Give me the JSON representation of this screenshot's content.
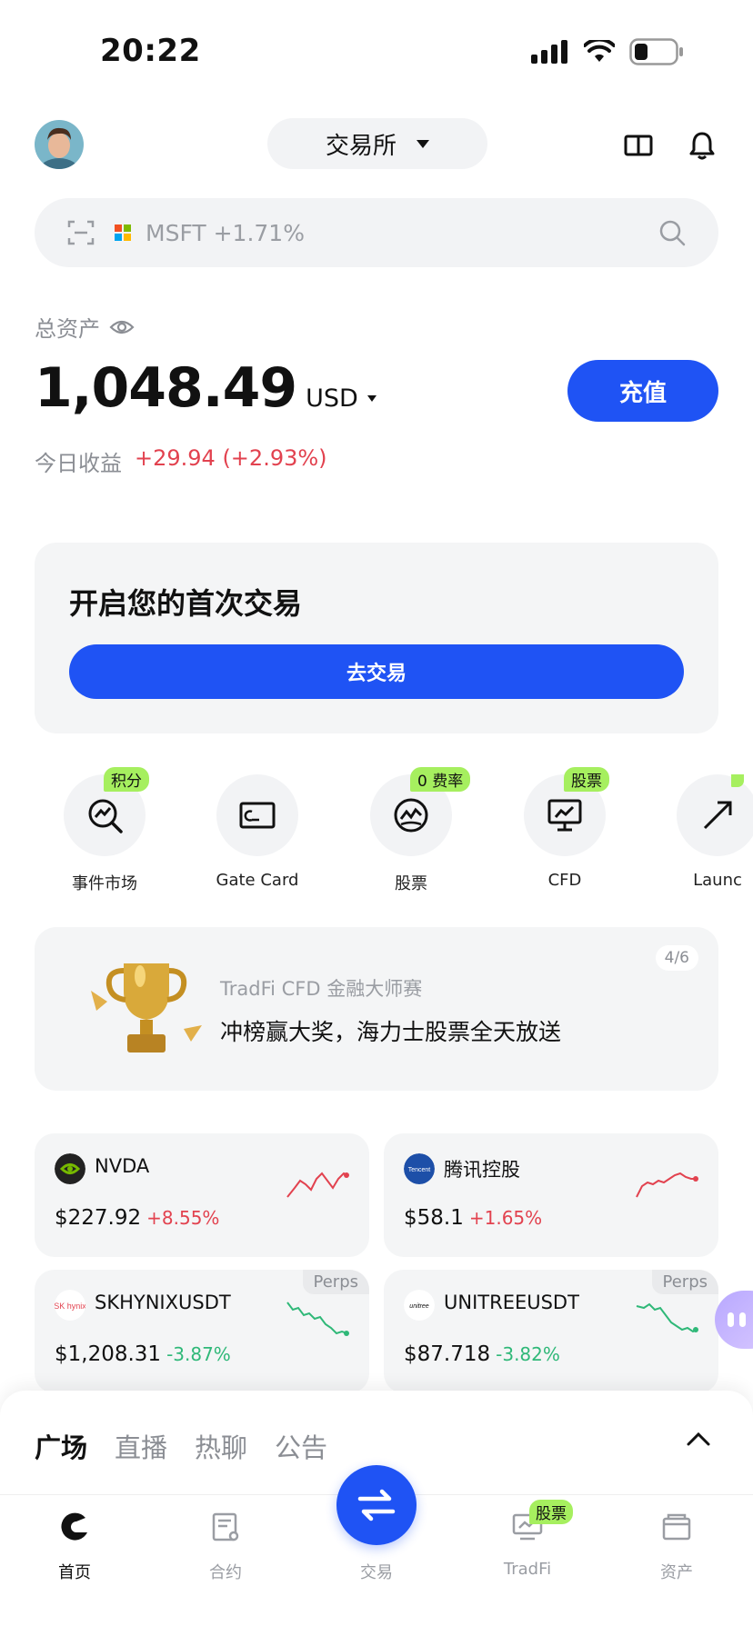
{
  "status_bar": {
    "time": "20:22"
  },
  "header": {
    "exchange_label": "交易所"
  },
  "search": {
    "ticker_text": "MSFT +1.71%"
  },
  "assets": {
    "label": "总资产",
    "value": "1,048.49",
    "unit": "USD",
    "deposit_label": "充值",
    "pnl_label": "今日收益",
    "pnl_value": "+29.94 (+2.93%)"
  },
  "first_trade": {
    "title": "开启您的首次交易",
    "button_label": "去交易"
  },
  "shortcuts": [
    {
      "label": "事件市场",
      "badge": "积分",
      "icon": "event-market-icon"
    },
    {
      "label": "Gate Card",
      "badge": "",
      "icon": "card-icon"
    },
    {
      "label": "股票",
      "badge": "0 费率",
      "icon": "stocks-icon"
    },
    {
      "label": "CFD",
      "badge": "股票",
      "icon": "cfd-icon"
    },
    {
      "label": "Launc",
      "badge": "",
      "icon": "launch-icon"
    }
  ],
  "banner": {
    "subtitle": "TradFi CFD 金融大师赛",
    "title": "冲榜赢大奖，海力士股票全天放送",
    "page": "4/6"
  },
  "tickers": [
    {
      "symbol": "NVDA",
      "price": "$227.92",
      "change": "+8.55%",
      "direction": "up",
      "perps": ""
    },
    {
      "symbol": "腾讯控股",
      "price": "$58.1",
      "change": "+1.65%",
      "direction": "up",
      "perps": ""
    },
    {
      "symbol": "SKHYNIXUSDT",
      "price": "$1,208.31",
      "change": "-3.87%",
      "direction": "down",
      "perps": "Perps"
    },
    {
      "symbol": "UNITREEUSDT",
      "price": "$87.718",
      "change": "-3.82%",
      "direction": "down",
      "perps": "Perps"
    }
  ],
  "logo_text": {
    "tencent": "Tencent",
    "sk": "SK hynix",
    "unitree": "unitree"
  },
  "sheet": {
    "tabs": [
      "广场",
      "直播",
      "热聊",
      "公告"
    ]
  },
  "nav": [
    {
      "label": "首页",
      "active": true
    },
    {
      "label": "合约",
      "active": false
    },
    {
      "label": "交易",
      "active": false
    },
    {
      "label": "TradFi",
      "active": false,
      "badge": "股票"
    },
    {
      "label": "资产",
      "active": false
    }
  ],
  "colors": {
    "accent": "#1f53f4",
    "up": "#e2424f",
    "down": "#2fb878",
    "badge": "#a6ef5f"
  }
}
